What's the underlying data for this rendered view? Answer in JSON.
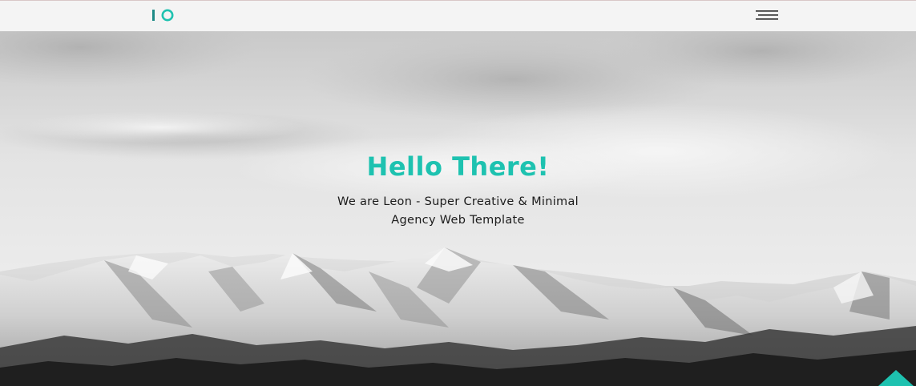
{
  "header": {
    "logo_text": "IO",
    "menu_icon": "hamburger-icon"
  },
  "hero": {
    "title": "Hello There!",
    "subtitle_line1": "We are Leon - Super Creative & Minimal",
    "subtitle_line2": "Agency Web Template"
  },
  "scroll_top": {
    "icon": "arrow-up-icon"
  },
  "colors": {
    "accent": "#1ec2b0",
    "header_bg": "#f4f4f4",
    "text_dark": "#1c1c1c"
  }
}
